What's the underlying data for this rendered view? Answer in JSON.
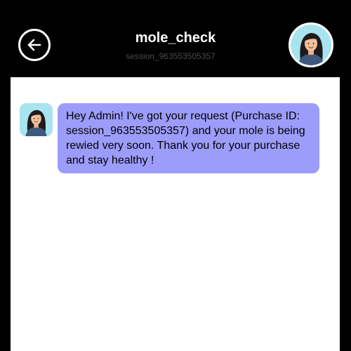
{
  "header": {
    "title": "mole_check",
    "session_id": "session_963553505357",
    "back_icon": "arrow-left-icon",
    "avatar_icon": "woman-avatar"
  },
  "messages": [
    {
      "sender_avatar": "woman-avatar",
      "text": "Hey Admin! I've got your request (Purchase ID: session_963553505357) and your mole is being rewied very soon. Thank you for your purchase and stay healthy !"
    }
  ],
  "colors": {
    "background": "#000000",
    "chat_background": "#ffffff",
    "bubble": "#9c9cfa",
    "avatar_background": "#a7e4ef"
  }
}
